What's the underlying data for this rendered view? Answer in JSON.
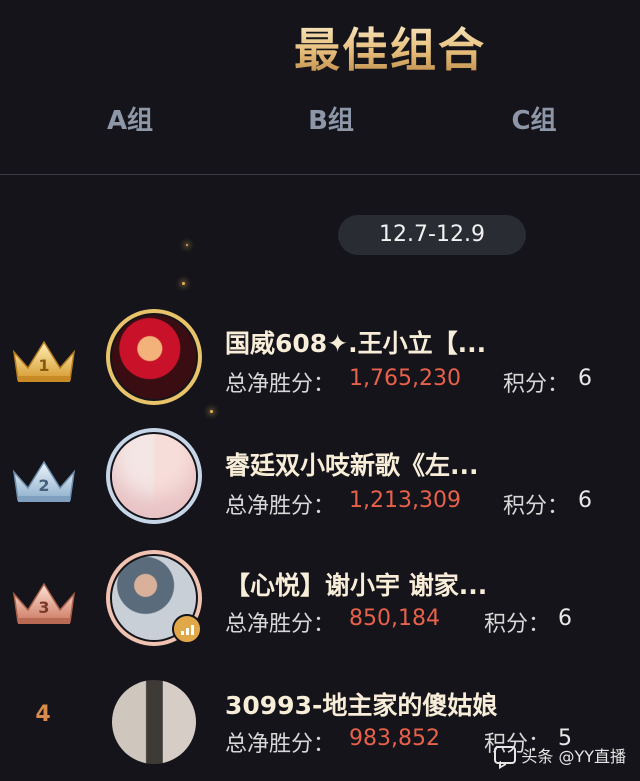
{
  "page": {
    "title": "最佳组合"
  },
  "tabs": [
    {
      "label": "A组"
    },
    {
      "label": "B组"
    },
    {
      "label": "C组"
    }
  ],
  "date_range": "12.7-12.9",
  "rankings": [
    {
      "rank": "1",
      "name": "国威608✦.王小立【...",
      "net_score_label": "总净胜分：",
      "net_score": "1,765,230",
      "points_label": "积分：",
      "points": "6",
      "ring_color": "#e8c36a",
      "badge_color": "#f0c05a"
    },
    {
      "rank": "2",
      "name": "睿廷双小吱新歌《左...",
      "net_score_label": "总净胜分：",
      "net_score": "1,213,309",
      "points_label": "积分：",
      "points": "6",
      "ring_color": "#c7d6e6",
      "badge_color": "#a9c3da"
    },
    {
      "rank": "3",
      "name": "【心悦】谢小宇 谢家...",
      "net_score_label": "总净胜分：",
      "net_score": "850,184",
      "points_label": "积分：",
      "points": "6",
      "ring_color": "#f0c2b1",
      "badge_color": "#e19a86"
    },
    {
      "rank": "4",
      "name": "30993-地主家的傻姑娘",
      "net_score_label": "总净胜分：",
      "net_score": "983,852",
      "points_label": "积分：",
      "points": "5"
    }
  ],
  "watermark": "头条 @YY直播",
  "colors": {
    "background": "#14141a",
    "accent_gold": "#e7bf7c",
    "score_red": "#e8614a",
    "tab_gray": "#8d97a7"
  }
}
